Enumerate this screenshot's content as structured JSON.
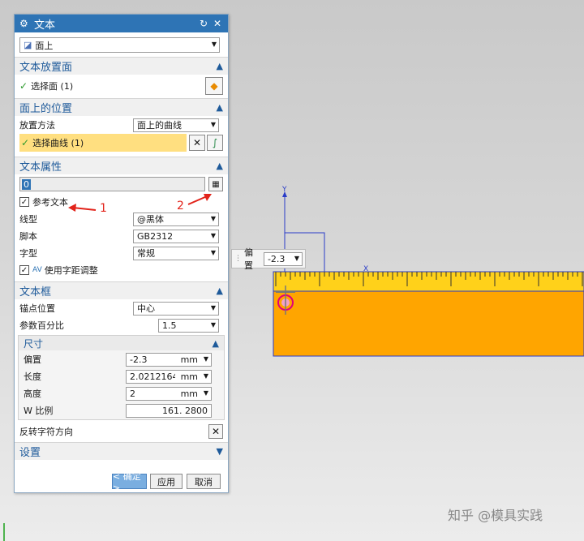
{
  "dialog": {
    "title": "文本",
    "type_dropdown": "面上"
  },
  "sections": {
    "placement_face": {
      "title": "文本放置面",
      "select_face": "选择面 (1)"
    },
    "position_on_face": {
      "title": "面上的位置",
      "method_label": "放置方法",
      "method_value": "面上的曲线",
      "select_curve": "选择曲线 (1)"
    },
    "text_props": {
      "title": "文本属性",
      "text_value": "0",
      "ref_text_label": "参考文本",
      "font_label": "线型",
      "font_value": "@黑体",
      "script_label": "脚本",
      "script_value": "GB2312",
      "style_label": "字型",
      "style_value": "常规",
      "kerning_label": "使用字距调整"
    },
    "text_box": {
      "title": "文本框",
      "anchor_label": "锚点位置",
      "anchor_value": "中心",
      "param_label": "参数百分比",
      "param_value": "1.5",
      "dims_title": "尺寸",
      "offset_label": "偏置",
      "offset_value": "-2.3",
      "length_label": "长度",
      "length_value": "2.02121640",
      "height_label": "高度",
      "height_value": "2",
      "unit": "mm",
      "wscale_label": "W 比例",
      "wscale_value": "161. 2800",
      "reverse_label": "反转字符方向"
    },
    "settings": {
      "title": "设置"
    }
  },
  "buttons": {
    "ok": "< 确定 >",
    "apply": "应用",
    "cancel": "取消"
  },
  "annotations": {
    "one": "1",
    "two": "2"
  },
  "viewport": {
    "offset_label": "偏置",
    "offset_value": "-2.3",
    "axis_y": "Y",
    "axis_x": "X",
    "watermark": "知乎 @模具实践",
    "colors": {
      "ruler": "#ffd11a",
      "block": "#ffa500"
    }
  }
}
